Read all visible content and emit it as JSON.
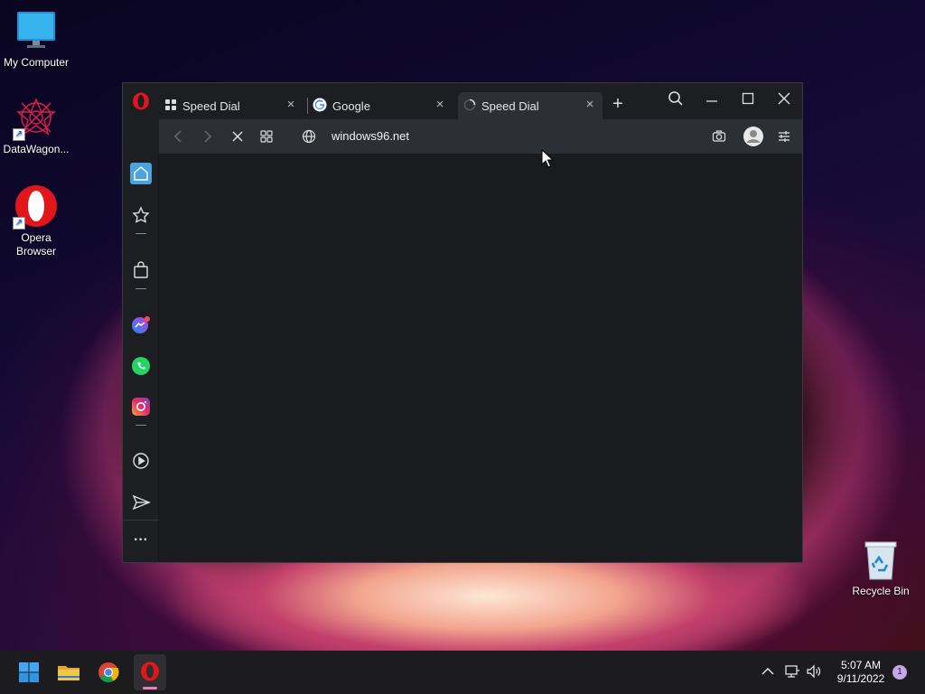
{
  "desktop": {
    "icons": [
      {
        "label": "My Computer",
        "icon": "monitor-icon"
      },
      {
        "label": "DataWagon...",
        "icon": "datawagon-icon"
      },
      {
        "label": "Opera Browser",
        "icon": "opera-icon"
      }
    ],
    "recycle_bin": {
      "label": "Recycle Bin",
      "icon": "recycle-bin-icon"
    }
  },
  "browser": {
    "tabs": [
      {
        "label": "Speed Dial",
        "icon": "speed-dial-icon",
        "active": false
      },
      {
        "label": "Google",
        "icon": "google-icon",
        "active": false
      },
      {
        "label": "Speed Dial",
        "icon": "loading-spinner-icon",
        "active": true
      }
    ],
    "new_tab_symbol": "+",
    "close_symbol": "×",
    "address": {
      "url": "windows96.net"
    },
    "sidebar": [
      "home-icon",
      "star-icon",
      "shopping-bag-icon",
      "messenger-icon",
      "whatsapp-icon",
      "instagram-icon",
      "player-icon",
      "send-icon",
      "more-icon"
    ],
    "more_label": "···"
  },
  "taskbar": {
    "time": "5:07 AM",
    "date": "9/11/2022",
    "notification_count": "1",
    "pinned": [
      "windows-start-icon",
      "file-explorer-icon",
      "chrome-icon",
      "opera-icon"
    ]
  },
  "colors": {
    "accent": "#4aa3df",
    "opera_red": "#e0161b",
    "window_bg": "#1d1e21",
    "toolbar_bg": "#2c3035"
  }
}
